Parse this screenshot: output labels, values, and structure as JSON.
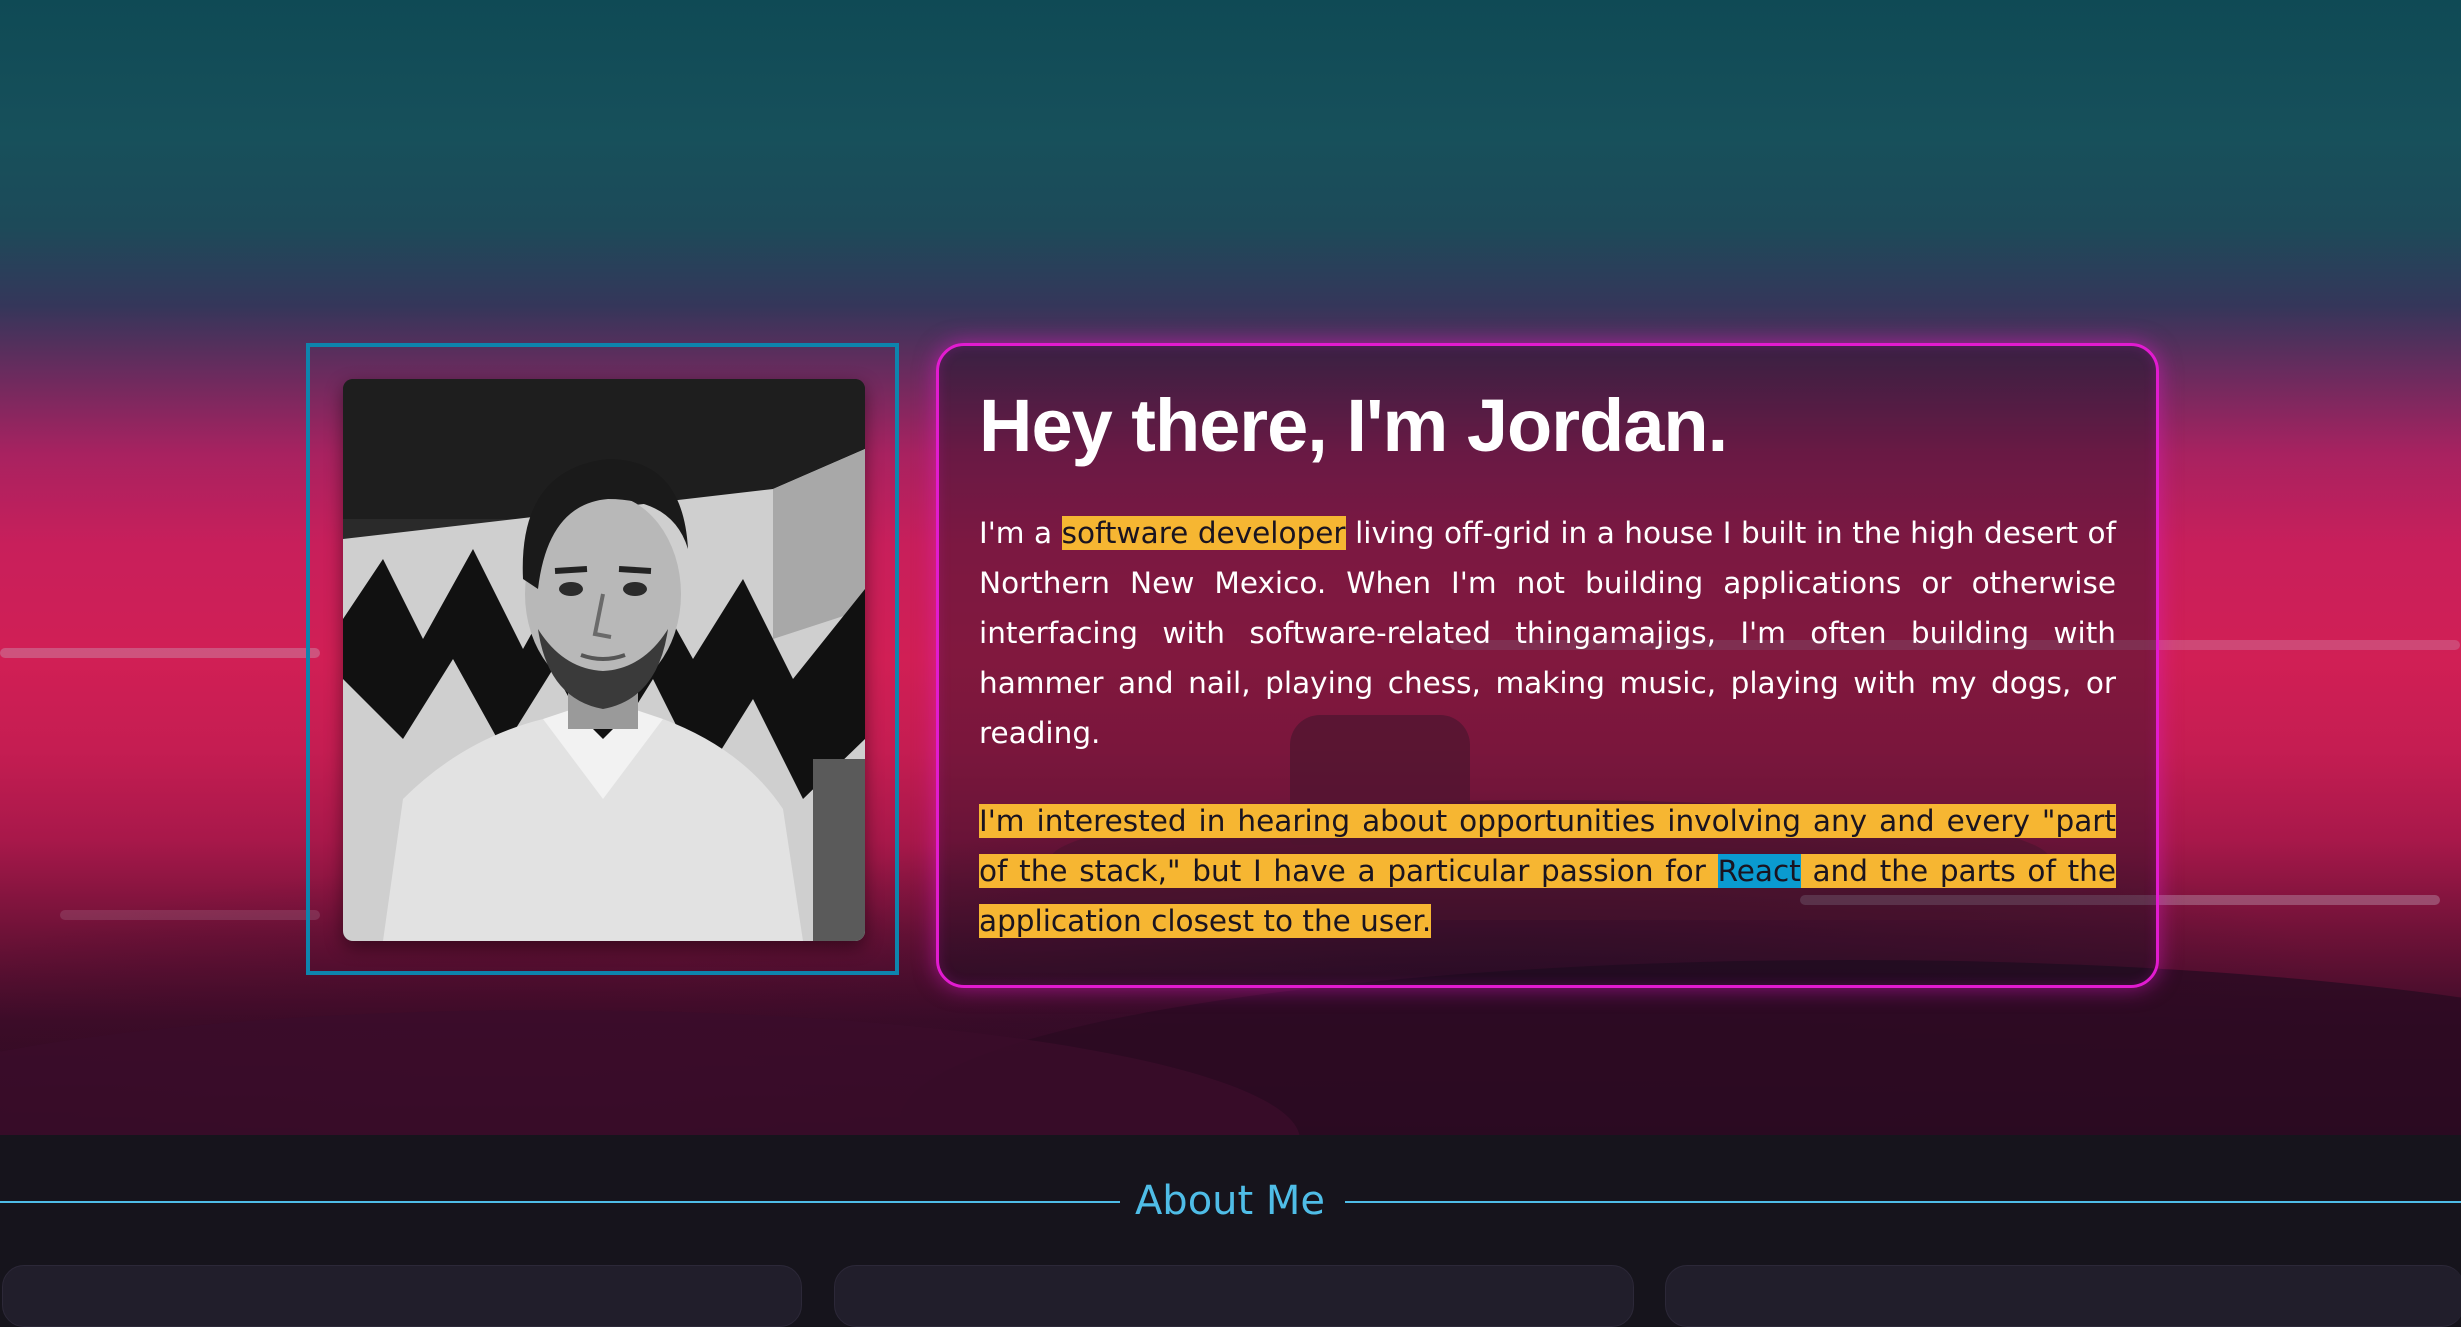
{
  "hero": {
    "heading": "Hey there, I'm Jordan.",
    "intro": {
      "before": "I'm a ",
      "highlight": "software developer",
      "after": " living off-grid in a house I built in the high desert of Northern New Mexico. When I'm not building applications or otherwise interfacing with software-related thingamajigs, I'm often building with hammer and nail, playing chess, making music, playing with my dogs, or reading."
    },
    "interest": {
      "before": "I'm interested in hearing about opportunities involving any and every \"part of the stack,\" but I have a particular passion for ",
      "highlight": "React",
      "after": " and the parts of the application closest to the user."
    }
  },
  "section": {
    "title": "About Me"
  },
  "colors": {
    "frame_accent": "#0e84ad",
    "card_border": "#e21bd0",
    "highlight_yellow": "#f6b632",
    "highlight_blue": "#0a9bd0",
    "section_title": "#4fbde7",
    "page_background": "#16141c"
  }
}
